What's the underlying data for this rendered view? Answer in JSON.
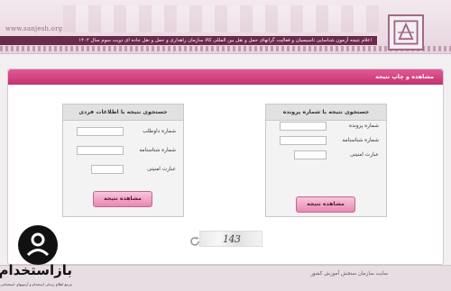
{
  "header": {
    "site_url": "www.sanjesh.org",
    "banner_text": "اعلام نتیجه آزمون شناسایی تاسیسیان و فعالیت گرانهای حمل و نقل بین المللی کالا سازمان راهداری و حمل و نقل جاده ای دوبت سوم سال ۱۴۰۲"
  },
  "main": {
    "title": "مشاهده و چاپ نتیجه"
  },
  "panel_right": {
    "title": "جستجوی نتیجه با شماره پرونده",
    "fields": [
      {
        "label": "شماره پرونده"
      },
      {
        "label": "شماره شناسنامه"
      },
      {
        "label": "عبارت امنیتی"
      }
    ],
    "button": "مشاهده نتیجه"
  },
  "panel_left": {
    "title": "جستجوی نتیجه با اطلاعات فردی",
    "fields": [
      {
        "label": "شماره داوطلب"
      },
      {
        "label": "شماره شناسنامه"
      },
      {
        "label": "عبارت امنیتی"
      }
    ],
    "button": "مشاهده نتیجه"
  },
  "captcha": {
    "text": "143",
    "refresh_icon": "refresh-icon"
  },
  "footer": {
    "text": "سایت سازمان سنجش آموزش کشور"
  },
  "watermark": {
    "brand": "بازاستخدام",
    "subtitle": "مرجع اطلاع رسانی استخدام و آزمونهای استخدامی"
  },
  "colors": {
    "title_bar": "#d2467f",
    "banner": "#6a2a4b",
    "button": "#eea4c4"
  }
}
